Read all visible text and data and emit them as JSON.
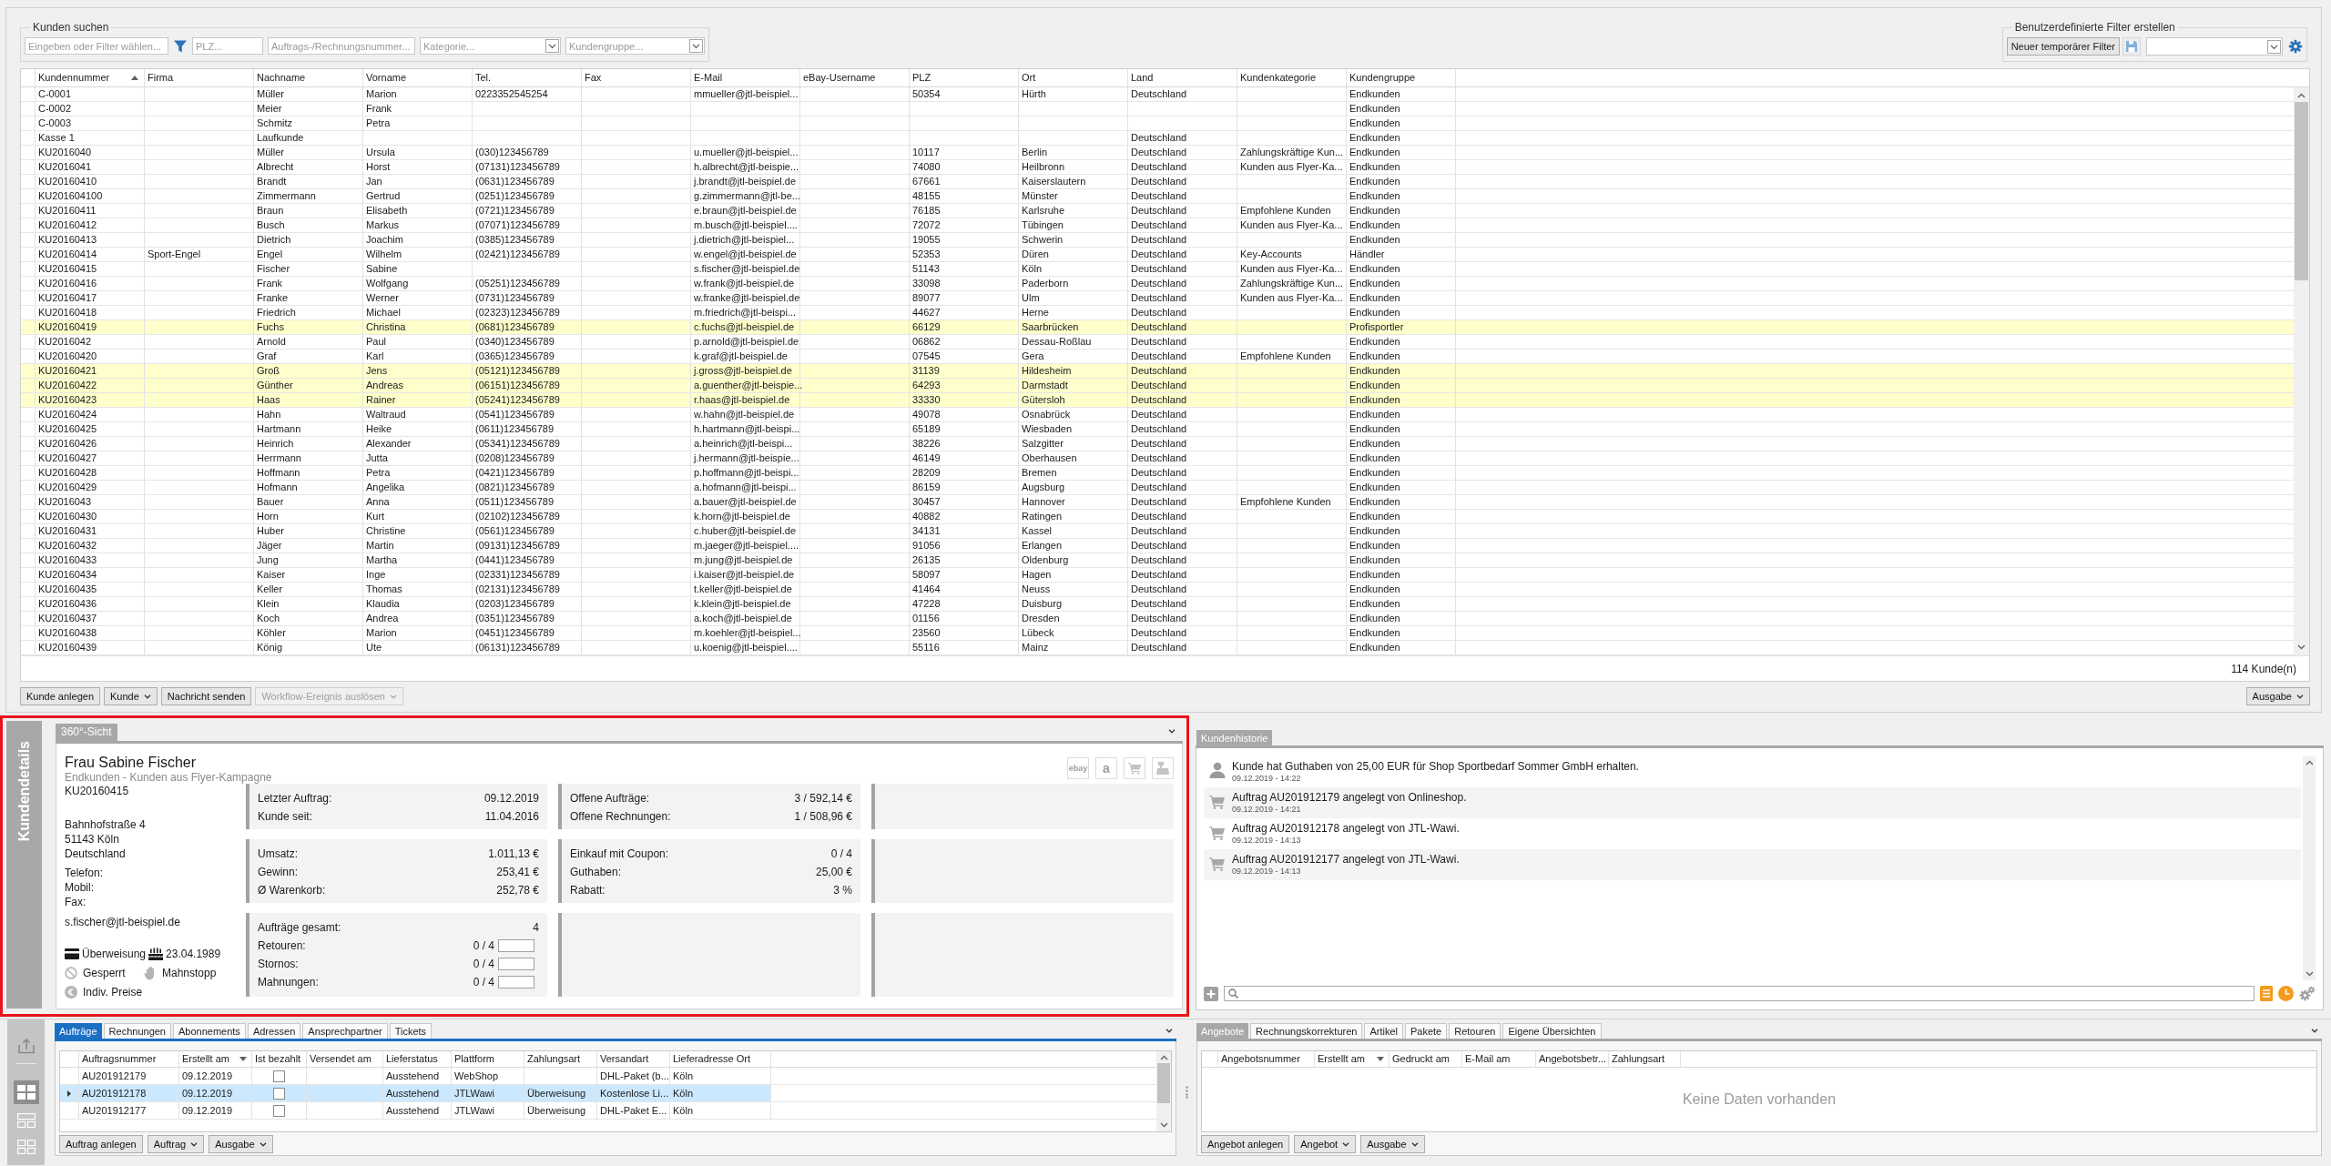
{
  "search": {
    "title": "Kunden suchen",
    "fields": [
      {
        "kind": "text",
        "placeholder": "Eingeben oder Filter wählen..."
      },
      {
        "kind": "text",
        "placeholder": "PLZ..."
      },
      {
        "kind": "text",
        "placeholder": "Auftrags-/Rechnungsnummer..."
      },
      {
        "kind": "dropdown",
        "placeholder": "Kategorie..."
      },
      {
        "kind": "dropdown",
        "placeholder": "Kundengruppe..."
      }
    ]
  },
  "custom_filter": {
    "title": "Benutzerdefinierte Filter erstellen",
    "button": "Neuer temporärer Filter"
  },
  "customer_table": {
    "columns": [
      {
        "label": "Kundennummer",
        "kind": "sorted_ascending"
      },
      {
        "label": "Firma",
        "kind": "plain"
      },
      {
        "label": "Nachname",
        "kind": "plain"
      },
      {
        "label": "Vorname",
        "kind": "plain"
      },
      {
        "label": "Tel.",
        "kind": "plain"
      },
      {
        "label": "Fax",
        "kind": "plain"
      },
      {
        "label": "E-Mail",
        "kind": "plain"
      },
      {
        "label": "eBay-Username",
        "kind": "plain"
      },
      {
        "label": "PLZ",
        "kind": "plain"
      },
      {
        "label": "Ort",
        "kind": "plain"
      },
      {
        "label": "Land",
        "kind": "plain"
      },
      {
        "label": "Kundenkategorie",
        "kind": "plain"
      },
      {
        "label": "Kundengruppe",
        "kind": "plain"
      }
    ],
    "rows": [
      {
        "number": "C-0001",
        "last_name": "Müller",
        "first_name": "Marion",
        "phone": "0223352545254",
        "email": "mmueller@jtl-beispiel...",
        "zip": "50354",
        "city": "Hürth",
        "country": "Deutschland",
        "group": "Endkunden",
        "highlighted": false
      },
      {
        "number": "C-0002",
        "last_name": "Meier",
        "first_name": "Frank",
        "group": "Endkunden",
        "highlighted": false
      },
      {
        "number": "C-0003",
        "last_name": "Schmitz",
        "first_name": "Petra",
        "group": "Endkunden",
        "highlighted": false
      },
      {
        "number": "Kasse 1",
        "last_name": "Laufkunde",
        "country": "Deutschland",
        "group": "Endkunden",
        "highlighted": false
      },
      {
        "number": "KU2016040",
        "last_name": "Müller",
        "first_name": "Ursula",
        "phone": "(030)123456789",
        "email": "u.mueller@jtl-beispiel...",
        "zip": "10117",
        "city": "Berlin",
        "country": "Deutschland",
        "category": "Zahlungskräftige Kun...",
        "group": "Endkunden",
        "highlighted": false
      },
      {
        "number": "KU2016041",
        "last_name": "Albrecht",
        "first_name": "Horst",
        "phone": "(07131)123456789",
        "email": "h.albrecht@jtl-beispie...",
        "zip": "74080",
        "city": "Heilbronn",
        "country": "Deutschland",
        "category": "Kunden aus Flyer-Ka...",
        "group": "Endkunden",
        "highlighted": false
      },
      {
        "number": "KU20160410",
        "last_name": "Brandt",
        "first_name": "Jan",
        "phone": "(0631)123456789",
        "email": "j.brandt@jtl-beispiel.de",
        "zip": "67661",
        "city": "Kaiserslautern",
        "country": "Deutschland",
        "group": "Endkunden",
        "highlighted": false
      },
      {
        "number": "KU201604100",
        "last_name": "Zimmermann",
        "first_name": "Gertrud",
        "phone": "(0251)123456789",
        "email": "g.zimmermann@jtl-be...",
        "zip": "48155",
        "city": "Münster",
        "country": "Deutschland",
        "group": "Endkunden",
        "highlighted": false
      },
      {
        "number": "KU20160411",
        "last_name": "Braun",
        "first_name": "Elisabeth",
        "phone": "(0721)123456789",
        "email": "e.braun@jtl-beispiel.de",
        "zip": "76185",
        "city": "Karlsruhe",
        "country": "Deutschland",
        "category": "Empfohlene Kunden",
        "group": "Endkunden",
        "highlighted": false
      },
      {
        "number": "KU20160412",
        "last_name": "Busch",
        "first_name": "Markus",
        "phone": "(07071)123456789",
        "email": "m.busch@jtl-beispiel....",
        "zip": "72072",
        "city": "Tübingen",
        "country": "Deutschland",
        "category": "Kunden aus Flyer-Ka...",
        "group": "Endkunden",
        "highlighted": false
      },
      {
        "number": "KU20160413",
        "last_name": "Dietrich",
        "first_name": "Joachim",
        "phone": "(0385)123456789",
        "email": "j.dietrich@jtl-beispiel...",
        "zip": "19055",
        "city": "Schwerin",
        "country": "Deutschland",
        "group": "Endkunden",
        "highlighted": false
      },
      {
        "number": "KU20160414",
        "company": "Sport-Engel",
        "last_name": "Engel",
        "first_name": "Wilhelm",
        "phone": "(02421)123456789",
        "email": "w.engel@jtl-beispiel.de",
        "zip": "52353",
        "city": "Düren",
        "country": "Deutschland",
        "category": "Key-Accounts",
        "group": "Händler",
        "highlighted": false
      },
      {
        "number": "KU20160415",
        "last_name": "Fischer",
        "first_name": "Sabine",
        "email": "s.fischer@jtl-beispiel.de",
        "zip": "51143",
        "city": "Köln",
        "country": "Deutschland",
        "category": "Kunden aus Flyer-Ka...",
        "group": "Endkunden",
        "highlighted": false
      },
      {
        "number": "KU20160416",
        "last_name": "Frank",
        "first_name": "Wolfgang",
        "phone": "(05251)123456789",
        "email": "w.frank@jtl-beispiel.de",
        "zip": "33098",
        "city": "Paderborn",
        "country": "Deutschland",
        "category": "Zahlungskräftige Kun...",
        "group": "Endkunden",
        "highlighted": false
      },
      {
        "number": "KU20160417",
        "last_name": "Franke",
        "first_name": "Werner",
        "phone": "(0731)123456789",
        "email": "w.franke@jtl-beispiel.de",
        "zip": "89077",
        "city": "Ulm",
        "country": "Deutschland",
        "category": "Kunden aus Flyer-Ka...",
        "group": "Endkunden",
        "highlighted": false
      },
      {
        "number": "KU20160418",
        "last_name": "Friedrich",
        "first_name": "Michael",
        "phone": "(02323)123456789",
        "email": "m.friedrich@jtl-beispi...",
        "zip": "44627",
        "city": "Herne",
        "country": "Deutschland",
        "group": "Endkunden",
        "highlighted": false
      },
      {
        "number": "KU20160419",
        "last_name": "Fuchs",
        "first_name": "Christina",
        "phone": "(0681)123456789",
        "email": "c.fuchs@jtl-beispiel.de",
        "zip": "66129",
        "city": "Saarbrücken",
        "country": "Deutschland",
        "group": "Profisportler",
        "highlighted": true
      },
      {
        "number": "KU2016042",
        "last_name": "Arnold",
        "first_name": "Paul",
        "phone": "(0340)123456789",
        "email": "p.arnold@jtl-beispiel.de",
        "zip": "06862",
        "city": "Dessau-Roßlau",
        "country": "Deutschland",
        "group": "Endkunden",
        "highlighted": false
      },
      {
        "number": "KU20160420",
        "last_name": "Graf",
        "first_name": "Karl",
        "phone": "(0365)123456789",
        "email": "k.graf@jtl-beispiel.de",
        "zip": "07545",
        "city": "Gera",
        "country": "Deutschland",
        "category": "Empfohlene Kunden",
        "group": "Endkunden",
        "highlighted": false
      },
      {
        "number": "KU20160421",
        "last_name": "Groß",
        "first_name": "Jens",
        "phone": "(05121)123456789",
        "email": "j.gross@jtl-beispiel.de",
        "zip": "31139",
        "city": "Hildesheim",
        "country": "Deutschland",
        "group": "Endkunden",
        "highlighted": true
      },
      {
        "number": "KU20160422",
        "last_name": "Günther",
        "first_name": "Andreas",
        "phone": "(06151)123456789",
        "email": "a.guenther@jtl-beispie...",
        "zip": "64293",
        "city": "Darmstadt",
        "country": "Deutschland",
        "group": "Endkunden",
        "highlighted": true
      },
      {
        "number": "KU20160423",
        "last_name": "Haas",
        "first_name": "Rainer",
        "phone": "(05241)123456789",
        "email": "r.haas@jtl-beispiel.de",
        "zip": "33330",
        "city": "Gütersloh",
        "country": "Deutschland",
        "group": "Endkunden",
        "highlighted": true
      },
      {
        "number": "KU20160424",
        "last_name": "Hahn",
        "first_name": "Waltraud",
        "phone": "(0541)123456789",
        "email": "w.hahn@jtl-beispiel.de",
        "zip": "49078",
        "city": "Osnabrück",
        "country": "Deutschland",
        "group": "Endkunden",
        "highlighted": false
      },
      {
        "number": "KU20160425",
        "last_name": "Hartmann",
        "first_name": "Heike",
        "phone": "(0611)123456789",
        "email": "h.hartmann@jtl-beispi...",
        "zip": "65189",
        "city": "Wiesbaden",
        "country": "Deutschland",
        "group": "Endkunden",
        "highlighted": false
      },
      {
        "number": "KU20160426",
        "last_name": "Heinrich",
        "first_name": "Alexander",
        "phone": "(05341)123456789",
        "email": "a.heinrich@jtl-beispi...",
        "zip": "38226",
        "city": "Salzgitter",
        "country": "Deutschland",
        "group": "Endkunden",
        "highlighted": false
      },
      {
        "number": "KU20160427",
        "last_name": "Herrmann",
        "first_name": "Jutta",
        "phone": "(0208)123456789",
        "email": "j.hermann@jtl-beispie...",
        "zip": "46149",
        "city": "Oberhausen",
        "country": "Deutschland",
        "group": "Endkunden",
        "highlighted": false
      },
      {
        "number": "KU20160428",
        "last_name": "Hoffmann",
        "first_name": "Petra",
        "phone": "(0421)123456789",
        "email": "p.hoffmann@jtl-beispi...",
        "zip": "28209",
        "city": "Bremen",
        "country": "Deutschland",
        "group": "Endkunden",
        "highlighted": false
      },
      {
        "number": "KU20160429",
        "last_name": "Hofmann",
        "first_name": "Angelika",
        "phone": "(0821)123456789",
        "email": "a.hofmann@jtl-beispi...",
        "zip": "86159",
        "city": "Augsburg",
        "country": "Deutschland",
        "group": "Endkunden",
        "highlighted": false
      },
      {
        "number": "KU2016043",
        "last_name": "Bauer",
        "first_name": "Anna",
        "phone": "(0511)123456789",
        "email": "a.bauer@jtl-beispiel.de",
        "zip": "30457",
        "city": "Hannover",
        "country": "Deutschland",
        "category": "Empfohlene Kunden",
        "group": "Endkunden",
        "highlighted": false
      },
      {
        "number": "KU20160430",
        "last_name": "Horn",
        "first_name": "Kurt",
        "phone": "(02102)123456789",
        "email": "k.horn@jtl-beispiel.de",
        "zip": "40882",
        "city": "Ratingen",
        "country": "Deutschland",
        "group": "Endkunden",
        "highlighted": false
      },
      {
        "number": "KU20160431",
        "last_name": "Huber",
        "first_name": "Christine",
        "phone": "(0561)123456789",
        "email": "c.huber@jtl-beispiel.de",
        "zip": "34131",
        "city": "Kassel",
        "country": "Deutschland",
        "group": "Endkunden",
        "highlighted": false
      },
      {
        "number": "KU20160432",
        "last_name": "Jäger",
        "first_name": "Martin",
        "phone": "(09131)123456789",
        "email": "m.jaeger@jtl-beispiel....",
        "zip": "91056",
        "city": "Erlangen",
        "country": "Deutschland",
        "group": "Endkunden",
        "highlighted": false
      },
      {
        "number": "KU20160433",
        "last_name": "Jung",
        "first_name": "Martha",
        "phone": "(0441)123456789",
        "email": "m.jung@jtl-beispiel.de",
        "zip": "26135",
        "city": "Oldenburg",
        "country": "Deutschland",
        "group": "Endkunden",
        "highlighted": false
      },
      {
        "number": "KU20160434",
        "last_name": "Kaiser",
        "first_name": "Inge",
        "phone": "(02331)123456789",
        "email": "i.kaiser@jtl-beispiel.de",
        "zip": "58097",
        "city": "Hagen",
        "country": "Deutschland",
        "group": "Endkunden",
        "highlighted": false
      },
      {
        "number": "KU20160435",
        "last_name": "Keller",
        "first_name": "Thomas",
        "phone": "(02131)123456789",
        "email": "t.keller@jtl-beispiel.de",
        "zip": "41464",
        "city": "Neuss",
        "country": "Deutschland",
        "group": "Endkunden",
        "highlighted": false
      },
      {
        "number": "KU20160436",
        "last_name": "Klein",
        "first_name": "Klaudia",
        "phone": "(0203)123456789",
        "email": "k.klein@jtl-beispiel.de",
        "zip": "47228",
        "city": "Duisburg",
        "country": "Deutschland",
        "group": "Endkunden",
        "highlighted": false
      },
      {
        "number": "KU20160437",
        "last_name": "Koch",
        "first_name": "Andrea",
        "phone": "(0351)123456789",
        "email": "a.koch@jtl-beispiel.de",
        "zip": "01156",
        "city": "Dresden",
        "country": "Deutschland",
        "group": "Endkunden",
        "highlighted": false
      },
      {
        "number": "KU20160438",
        "last_name": "Köhler",
        "first_name": "Marion",
        "phone": "(0451)123456789",
        "email": "m.koehler@jtl-beispiel...",
        "zip": "23560",
        "city": "Lübeck",
        "country": "Deutschland",
        "group": "Endkunden",
        "highlighted": false
      },
      {
        "number": "KU20160439",
        "last_name": "König",
        "first_name": "Ute",
        "phone": "(06131)123456789",
        "email": "u.koenig@jtl-beispiel....",
        "zip": "55116",
        "city": "Mainz",
        "country": "Deutschland",
        "group": "Endkunden",
        "highlighted": false
      }
    ],
    "count": "114 Kunde(n)"
  },
  "customer_actions": [
    {
      "label": "Kunde anlegen",
      "dropdown": false,
      "disabled": false
    },
    {
      "label": "Kunde",
      "dropdown": true,
      "disabled": false
    },
    {
      "label": "Nachricht senden",
      "dropdown": false,
      "disabled": false
    },
    {
      "label": "Workflow-Ereignis auslösen",
      "dropdown": true,
      "disabled": true
    }
  ],
  "output_button": {
    "label": "Ausgabe",
    "dropdown": true,
    "disabled": false
  },
  "details": {
    "side_tab": "Kundendetails",
    "focused": false,
    "tabs": [
      {
        "label": "360°-Sicht",
        "selected": true
      }
    ],
    "name": "Frau Sabine Fischer",
    "subtitle": "Endkunden - Kunden aus Flyer-Kampagne",
    "number": "KU20160415",
    "address": [
      "Bahnhofstraße 4",
      "51143 Köln",
      "Deutschland"
    ],
    "contact_labels": [
      "Telefon:",
      "Mobil:",
      "Fax:"
    ],
    "email": "s.fischer@jtl-beispiel.de",
    "payment": "Überweisung",
    "birthday": "23.04.1989",
    "flags": [
      {
        "kind": "blocked",
        "label": "Gesperrt",
        "on": false
      },
      {
        "kind": "dunning_stop",
        "label": "Mahnstopp",
        "on": false
      },
      {
        "kind": "custom_prices",
        "label": "Indiv. Preise",
        "on": false
      }
    ],
    "channels": [
      {
        "kind": "ebay",
        "label": "ebay",
        "enabled": false
      },
      {
        "kind": "amazon",
        "label": "a",
        "enabled": false
      },
      {
        "kind": "shop",
        "enabled": false
      },
      {
        "kind": "pos",
        "enabled": false
      }
    ],
    "stat_boxes": [
      {
        "kind": "stats",
        "lines": [
          {
            "kind": "plain",
            "label": "Letzter Auftrag:",
            "value": "09.12.2019"
          },
          {
            "kind": "plain",
            "label": "Kunde seit:",
            "value": "11.04.2016"
          }
        ]
      },
      {
        "kind": "stats",
        "lines": [
          {
            "kind": "plain",
            "label": "Offene Aufträge:",
            "value": "3 / 592,14 €"
          },
          {
            "kind": "plain",
            "label": "Offene Rechnungen:",
            "value": "1 / 508,96 €"
          }
        ]
      },
      {
        "kind": "empty"
      },
      {
        "kind": "stats",
        "lines": [
          {
            "kind": "plain",
            "label": "Umsatz:",
            "value": "1.011,13 €"
          },
          {
            "kind": "plain",
            "label": "Gewinn:",
            "value": "253,41 €"
          },
          {
            "kind": "plain",
            "label": "Ø Warenkorb:",
            "value": "252,78 €"
          }
        ]
      },
      {
        "kind": "stats",
        "lines": [
          {
            "kind": "plain",
            "label": "Einkauf mit Coupon:",
            "value": "0 / 4"
          },
          {
            "kind": "plain",
            "label": "Guthaben:",
            "value": "25,00 €"
          },
          {
            "kind": "plain",
            "label": "Rabatt:",
            "value": "3 %"
          }
        ]
      },
      {
        "kind": "empty"
      },
      {
        "kind": "stats",
        "lines": [
          {
            "kind": "plain",
            "label": "Aufträge gesamt:",
            "value": "4"
          },
          {
            "kind": "bar",
            "label": "Retouren:",
            "value": "0 / 4",
            "level": 0
          },
          {
            "kind": "bar",
            "label": "Stornos:",
            "value": "0 / 4",
            "level": 0
          },
          {
            "kind": "bar",
            "label": "Mahnungen:",
            "value": "0 / 4",
            "level": 0
          }
        ]
      },
      {
        "kind": "empty"
      },
      {
        "kind": "empty"
      }
    ]
  },
  "history": {
    "focused": false,
    "tabs": [
      {
        "label": "Kundenhistorie",
        "selected": true
      }
    ],
    "entries": [
      {
        "kind": "credit",
        "text": "Kunde hat Guthaben von 25,00 EUR für Shop Sportbedarf Sommer GmbH erhalten.",
        "time": "09.12.2019 - 14:22"
      },
      {
        "kind": "order",
        "text": "Auftrag AU201912179 angelegt von Onlineshop.",
        "time": "09.12.2019 - 14:21"
      },
      {
        "kind": "order",
        "text": "Auftrag AU201912178 angelegt von JTL-Wawi.",
        "time": "09.12.2019 - 14:13"
      },
      {
        "kind": "order",
        "text": "Auftrag AU201912177 angelegt von JTL-Wawi.",
        "time": "09.12.2019 - 14:13"
      }
    ]
  },
  "layout_switcher": [
    {
      "kind": "export",
      "selected": false
    },
    {
      "kind": "grid",
      "selected": true
    },
    {
      "kind": "rows",
      "selected": false
    },
    {
      "kind": "tiles",
      "selected": false
    }
  ],
  "orders": {
    "focused": true,
    "tabs": [
      {
        "label": "Aufträge",
        "selected": true
      },
      {
        "label": "Rechnungen",
        "selected": false
      },
      {
        "label": "Abonnements",
        "selected": false
      },
      {
        "label": "Adressen",
        "selected": false
      },
      {
        "label": "Ansprechpartner",
        "selected": false
      },
      {
        "label": "Tickets",
        "selected": false
      }
    ],
    "columns": [
      {
        "label": "Auftragsnummer",
        "kind": "plain"
      },
      {
        "label": "Erstellt am",
        "kind": "sorted_descending"
      },
      {
        "label": "Ist bezahlt",
        "kind": "plain"
      },
      {
        "label": "Versendet am",
        "kind": "plain"
      },
      {
        "label": "Lieferstatus",
        "kind": "plain"
      },
      {
        "label": "Plattform",
        "kind": "plain"
      },
      {
        "label": "Zahlungsart",
        "kind": "plain"
      },
      {
        "label": "Versandart",
        "kind": "plain"
      },
      {
        "label": "Lieferadresse Ort",
        "kind": "plain"
      }
    ],
    "rows": [
      {
        "selected": false,
        "number": "AU201912179",
        "created": "09.12.2019",
        "paid": false,
        "status": "Ausstehend",
        "platform": "WebShop",
        "shipping": "DHL-Paket (b...",
        "city": "Köln"
      },
      {
        "selected": true,
        "number": "AU201912178",
        "created": "09.12.2019",
        "paid": false,
        "status": "Ausstehend",
        "platform": "JTLWawi",
        "payment": "Überweisung",
        "shipping": "Kostenlose Li...",
        "city": "Köln"
      },
      {
        "selected": false,
        "number": "AU201912177",
        "created": "09.12.2019",
        "paid": false,
        "status": "Ausstehend",
        "platform": "JTLWawi",
        "payment": "Überweisung",
        "shipping": "DHL-Paket E...",
        "city": "Köln"
      }
    ],
    "buttons": [
      {
        "label": "Auftrag anlegen",
        "dropdown": false,
        "disabled": false
      },
      {
        "label": "Auftrag",
        "dropdown": true,
        "disabled": false
      },
      {
        "label": "Ausgabe",
        "dropdown": true,
        "disabled": false
      }
    ]
  },
  "offers": {
    "focused": false,
    "tabs": [
      {
        "label": "Angebote",
        "selected": true
      },
      {
        "label": "Rechnungskorrekturen",
        "selected": false
      },
      {
        "label": "Artikel",
        "selected": false
      },
      {
        "label": "Pakete",
        "selected": false
      },
      {
        "label": "Retouren",
        "selected": false
      },
      {
        "label": "Eigene Übersichten",
        "selected": false
      }
    ],
    "columns": [
      {
        "label": "Angebotsnummer",
        "kind": "plain"
      },
      {
        "label": "Erstellt am",
        "kind": "sorted_descending"
      },
      {
        "label": "Gedruckt am",
        "kind": "plain"
      },
      {
        "label": "E-Mail am",
        "kind": "plain"
      },
      {
        "label": "Angebotsbetr...",
        "kind": "plain"
      },
      {
        "label": "Zahlungsart",
        "kind": "plain"
      }
    ],
    "empty_message": "Keine Daten vorhanden",
    "buttons": [
      {
        "label": "Angebot anlegen",
        "dropdown": false,
        "disabled": false
      },
      {
        "label": "Angebot",
        "dropdown": true,
        "disabled": false
      },
      {
        "label": "Ausgabe",
        "dropdown": true,
        "disabled": false
      }
    ]
  }
}
